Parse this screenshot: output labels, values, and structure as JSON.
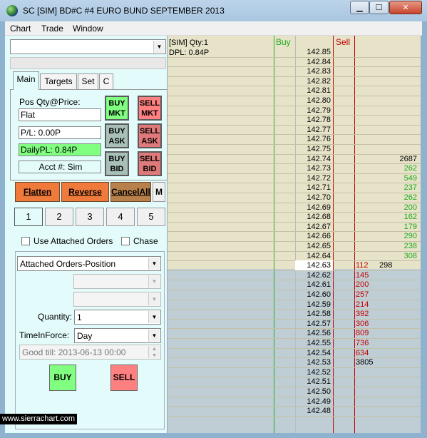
{
  "window": {
    "title": "SC [SIM] BD#C  #4  EURO BUND SEPTEMBER 2013",
    "buttons": {
      "minimize": "▁",
      "maximize": "☐",
      "close": "✕"
    }
  },
  "menu": [
    "Chart",
    "Trade",
    "Window"
  ],
  "panel": {
    "symbol_combo": "",
    "tabs": [
      "Main",
      "Targets",
      "Set",
      "C"
    ],
    "pos_qty_label": "Pos Qty@Price:",
    "position": "Flat",
    "pl": "P/L: 0.00P",
    "daily_pl": "DailyPL: 0.84P",
    "acct": "Acct #: Sim",
    "order_buttons": {
      "buy_mkt": [
        "BUY",
        "MKT"
      ],
      "sell_mkt": [
        "SELL",
        "MKT"
      ],
      "buy_ask": [
        "BUY",
        "ASK"
      ],
      "sell_ask": [
        "SELL",
        "ASK"
      ],
      "buy_bid": [
        "BUY",
        "BID"
      ],
      "sell_bid": [
        "SELL",
        "BID"
      ]
    },
    "actions": {
      "flatten": "Flatten",
      "reverse": "Reverse",
      "cancel_all": "CancelAll",
      "m": "M"
    },
    "quantity_presets": [
      "1",
      "2",
      "3",
      "4",
      "5"
    ],
    "use_attached_orders": "Use Attached Orders",
    "chase": "Chase",
    "attached_orders": "Attached Orders-Position",
    "quantity_label": "Quantity:",
    "quantity": "1",
    "tif_label": "TimeInForce:",
    "tif": "Day",
    "good_till": "Good till: 2013-06-13 00:00",
    "buy": "BUY",
    "sell": "SELL"
  },
  "watermark": "www.sierrachart.com",
  "ladder": {
    "sim_label": "[SIM]  Qty:1",
    "dpl_label": "DPL: 0.84P",
    "buy_header": "Buy",
    "sell_header": "Sell",
    "current_price": "142.63",
    "rows": [
      {
        "price": "142.85",
        "ask": "",
        "bid": ""
      },
      {
        "price": "142.84",
        "ask": "",
        "bid": ""
      },
      {
        "price": "142.83",
        "ask": "",
        "bid": ""
      },
      {
        "price": "142.82",
        "ask": "",
        "bid": ""
      },
      {
        "price": "142.81",
        "ask": "",
        "bid": ""
      },
      {
        "price": "142.80",
        "ask": "",
        "bid": ""
      },
      {
        "price": "142.79",
        "ask": "",
        "bid": ""
      },
      {
        "price": "142.78",
        "ask": "",
        "bid": ""
      },
      {
        "price": "142.77",
        "ask": "",
        "bid": ""
      },
      {
        "price": "142.76",
        "ask": "",
        "bid": ""
      },
      {
        "price": "142.75",
        "ask": "",
        "bid": ""
      },
      {
        "price": "142.74",
        "ask": "2687",
        "bid": ""
      },
      {
        "price": "142.73",
        "ask": "262",
        "bid": ""
      },
      {
        "price": "142.72",
        "ask": "549",
        "bid": ""
      },
      {
        "price": "142.71",
        "ask": "237",
        "bid": ""
      },
      {
        "price": "142.70",
        "ask": "262",
        "bid": ""
      },
      {
        "price": "142.69",
        "ask": "200",
        "bid": ""
      },
      {
        "price": "142.68",
        "ask": "162",
        "bid": ""
      },
      {
        "price": "142.67",
        "ask": "179",
        "bid": ""
      },
      {
        "price": "142.66",
        "ask": "290",
        "bid": ""
      },
      {
        "price": "142.65",
        "ask": "238",
        "bid": ""
      },
      {
        "price": "142.64",
        "ask": "308",
        "bid": ""
      },
      {
        "price": "142.63",
        "ask": "",
        "bid": "112",
        "extra": "298"
      },
      {
        "price": "142.62",
        "ask": "",
        "bid": "145"
      },
      {
        "price": "142.61",
        "ask": "",
        "bid": "200"
      },
      {
        "price": "142.60",
        "ask": "",
        "bid": "257"
      },
      {
        "price": "142.59",
        "ask": "",
        "bid": "214"
      },
      {
        "price": "142.58",
        "ask": "",
        "bid": "392"
      },
      {
        "price": "142.57",
        "ask": "",
        "bid": "306"
      },
      {
        "price": "142.56",
        "ask": "",
        "bid": "809"
      },
      {
        "price": "142.55",
        "ask": "",
        "bid": "736"
      },
      {
        "price": "142.54",
        "ask": "",
        "bid": "634"
      },
      {
        "price": "142.53",
        "ask": "",
        "bid": "3805"
      },
      {
        "price": "142.52",
        "ask": "",
        "bid": ""
      },
      {
        "price": "142.51",
        "ask": "",
        "bid": ""
      },
      {
        "price": "142.50",
        "ask": "",
        "bid": ""
      },
      {
        "price": "142.49",
        "ask": "",
        "bid": ""
      },
      {
        "price": "142.48",
        "ask": "",
        "bid": ""
      }
    ]
  },
  "colors": {
    "buy_green": "#80ff80",
    "sell_red": "#ff8080",
    "ask_text": "#22aa22",
    "bid_text": "#c00000",
    "buy_line": "#22aa22",
    "sell_line": "#c00000"
  }
}
